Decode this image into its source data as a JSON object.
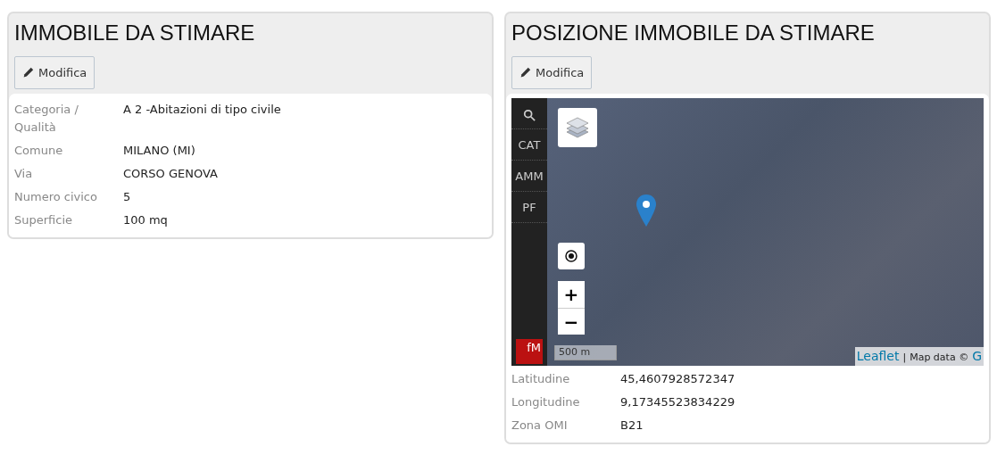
{
  "cards": [
    {
      "title": "IMMOBILE DA STIMARE",
      "button": "Modifica",
      "fields": [
        {
          "label": "Categoria / Qualità",
          "value": "A 2 -Abitazioni di tipo civile"
        },
        {
          "label": "Comune",
          "value": "MILANO (MI)"
        },
        {
          "label": "Via",
          "value": "CORSO GENOVA"
        },
        {
          "label": "Numero civico",
          "value": "5"
        },
        {
          "label": "Superficie",
          "value": "100 mq"
        }
      ]
    },
    {
      "title": "POSIZIONE IMMOBILE DA STIMARE",
      "button": "Modifica",
      "map": {
        "sidebar": [
          "CAT",
          "AMM",
          "PF"
        ],
        "zoom_in": "+",
        "zoom_out": "−",
        "scale": "500 m",
        "logo": "fM",
        "attribution": {
          "link": "Leaflet",
          "separator": "|",
          "text": "Map data ©",
          "link_2": "G"
        }
      },
      "fields": [
        {
          "label": "Latitudine",
          "value": "45,4607928572347"
        },
        {
          "label": "Longitudine",
          "value": "9,17345523834229"
        },
        {
          "label": "Zona OMI",
          "value": "B21"
        }
      ]
    }
  ]
}
